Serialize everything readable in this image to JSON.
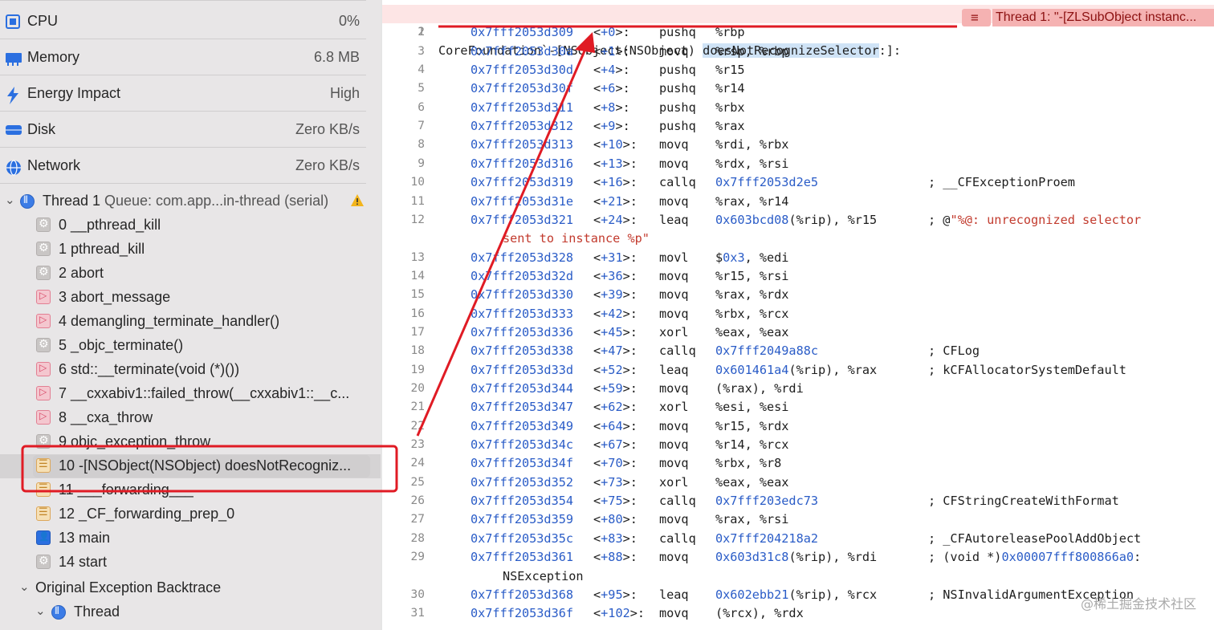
{
  "gauges": [
    {
      "label": "CPU",
      "value": "0%"
    },
    {
      "label": "Memory",
      "value": "6.8 MB"
    },
    {
      "label": "Energy Impact",
      "value": "High"
    },
    {
      "label": "Disk",
      "value": "Zero KB/s"
    },
    {
      "label": "Network",
      "value": "Zero KB/s"
    }
  ],
  "thread": {
    "name": "Thread 1",
    "queue": "Queue: com.app...in-thread (serial)"
  },
  "frames": [
    {
      "label": "0 __pthread_kill",
      "icon": "gear"
    },
    {
      "label": "1 pthread_kill",
      "icon": "gear"
    },
    {
      "label": "2 abort",
      "icon": "gear"
    },
    {
      "label": "3 abort_message",
      "icon": "cpp"
    },
    {
      "label": "4 demangling_terminate_handler()",
      "icon": "cpp"
    },
    {
      "label": "5 _objc_terminate()",
      "icon": "gear"
    },
    {
      "label": "6 std::__terminate(void (*)())",
      "icon": "cpp"
    },
    {
      "label": "7 __cxxabiv1::failed_throw(__cxxabiv1::__c...",
      "icon": "cpp"
    },
    {
      "label": "8 __cxa_throw",
      "icon": "cpp"
    },
    {
      "label": "9 objc_exception_throw",
      "icon": "gear"
    },
    {
      "label": "10 -[NSObject(NSObject) doesNotRecogniz...",
      "icon": "objc"
    },
    {
      "label": "11 ___forwarding___",
      "icon": "objc"
    },
    {
      "label": "12 _CF_forwarding_prep_0",
      "icon": "objc"
    },
    {
      "label": "13 main",
      "icon": "user"
    },
    {
      "label": "14 start",
      "icon": "gear"
    }
  ],
  "original_backtrace": {
    "label": "Original Exception Backtrace",
    "thread_label": "Thread"
  },
  "editor": {
    "line1": {
      "num": "1",
      "prefix": "CoreFoundation`-[NSObject(NSObject) ",
      "selected": "doesNotRecognizeSelector",
      "suffix": ":]:"
    },
    "error_message": "Thread 1: \"-[ZLSubObject instanc...",
    "lines": [
      {
        "n": "2",
        "addr": "0x7fff2053d309",
        "off": "+0",
        "mn": "pushq",
        "ops": "%rbp"
      },
      {
        "n": "3",
        "addr": "0x7fff2053d30a",
        "off": "+1",
        "mn": "movq",
        "ops": "%rsp, %rbp"
      },
      {
        "n": "4",
        "addr": "0x7fff2053d30d",
        "off": "+4",
        "mn": "pushq",
        "ops": "%r15"
      },
      {
        "n": "5",
        "addr": "0x7fff2053d30f",
        "off": "+6",
        "mn": "pushq",
        "ops": "%r14"
      },
      {
        "n": "6",
        "addr": "0x7fff2053d311",
        "off": "+8",
        "mn": "pushq",
        "ops": "%rbx"
      },
      {
        "n": "7",
        "addr": "0x7fff2053d312",
        "off": "+9",
        "mn": "pushq",
        "ops": "%rax"
      },
      {
        "n": "8",
        "addr": "0x7fff2053d313",
        "off": "+10",
        "mn": "movq",
        "ops": "%rdi, %rbx"
      },
      {
        "n": "9",
        "addr": "0x7fff2053d316",
        "off": "+13",
        "mn": "movq",
        "ops": "%rdx, %rsi"
      },
      {
        "n": "10",
        "addr": "0x7fff2053d319",
        "off": "+16",
        "mn": "callq",
        "ops_num": "0x7fff2053d2e5",
        "cm": "; __CFExceptionProem"
      },
      {
        "n": "11",
        "addr": "0x7fff2053d31e",
        "off": "+21",
        "mn": "movq",
        "ops": "%rax, %r14"
      },
      {
        "n": "12",
        "addr": "0x7fff2053d321",
        "off": "+24",
        "mn": "leaq",
        "ops_num": "0x603bcd08",
        "ops_tail": "(%rip), %r15",
        "cm": "; @",
        "cm_str": "\"%@: unrecognized selector",
        "wrap_str": "sent to instance %p\""
      },
      {
        "n": "13",
        "addr": "0x7fff2053d328",
        "off": "+31",
        "mn": "movl",
        "ops_pre": "$",
        "ops_num": "0x3",
        "ops_tail": ", %edi"
      },
      {
        "n": "14",
        "addr": "0x7fff2053d32d",
        "off": "+36",
        "mn": "movq",
        "ops": "%r15, %rsi"
      },
      {
        "n": "15",
        "addr": "0x7fff2053d330",
        "off": "+39",
        "mn": "movq",
        "ops": "%rax, %rdx"
      },
      {
        "n": "16",
        "addr": "0x7fff2053d333",
        "off": "+42",
        "mn": "movq",
        "ops": "%rbx, %rcx"
      },
      {
        "n": "17",
        "addr": "0x7fff2053d336",
        "off": "+45",
        "mn": "xorl",
        "ops": "%eax, %eax"
      },
      {
        "n": "18",
        "addr": "0x7fff2053d338",
        "off": "+47",
        "mn": "callq",
        "ops_num": "0x7fff2049a88c",
        "cm": "; CFLog"
      },
      {
        "n": "19",
        "addr": "0x7fff2053d33d",
        "off": "+52",
        "mn": "leaq",
        "ops_num": "0x601461a4",
        "ops_tail": "(%rip), %rax",
        "cm": "; kCFAllocatorSystemDefault"
      },
      {
        "n": "20",
        "addr": "0x7fff2053d344",
        "off": "+59",
        "mn": "movq",
        "ops": "(%rax), %rdi"
      },
      {
        "n": "21",
        "addr": "0x7fff2053d347",
        "off": "+62",
        "mn": "xorl",
        "ops": "%esi, %esi"
      },
      {
        "n": "22",
        "addr": "0x7fff2053d349",
        "off": "+64",
        "mn": "movq",
        "ops": "%r15, %rdx"
      },
      {
        "n": "23",
        "addr": "0x7fff2053d34c",
        "off": "+67",
        "mn": "movq",
        "ops": "%r14, %rcx"
      },
      {
        "n": "24",
        "addr": "0x7fff2053d34f",
        "off": "+70",
        "mn": "movq",
        "ops": "%rbx, %r8"
      },
      {
        "n": "25",
        "addr": "0x7fff2053d352",
        "off": "+73",
        "mn": "xorl",
        "ops": "%eax, %eax"
      },
      {
        "n": "26",
        "addr": "0x7fff2053d354",
        "off": "+75",
        "mn": "callq",
        "ops_num": "0x7fff203edc73",
        "cm": "; CFStringCreateWithFormat"
      },
      {
        "n": "27",
        "addr": "0x7fff2053d359",
        "off": "+80",
        "mn": "movq",
        "ops": "%rax, %rsi"
      },
      {
        "n": "28",
        "addr": "0x7fff2053d35c",
        "off": "+83",
        "mn": "callq",
        "ops_num": "0x7fff204218a2",
        "cm": "; _CFAutoreleasePoolAddObject"
      },
      {
        "n": "29",
        "addr": "0x7fff2053d361",
        "off": "+88",
        "mn": "movq",
        "ops_num": "0x603d31c8",
        "ops_tail": "(%rip), %rdi",
        "cm": "; (void *)",
        "cm_num": "0x00007fff800866a0",
        "cm_tail": ":",
        "wrap_plain": "NSException"
      },
      {
        "n": "30",
        "addr": "0x7fff2053d368",
        "off": "+95",
        "mn": "leaq",
        "ops_num": "0x602ebb21",
        "ops_tail": "(%rip), %rcx",
        "cm": "; NSInvalidArgumentException"
      },
      {
        "n": "31",
        "addr": "0x7fff2053d36f",
        "off": "+102",
        "mn": "movq",
        "ops": "(%rcx), %rdx"
      }
    ]
  },
  "watermark": "@稀土掘金技术社区",
  "colors": {
    "annotation_red": "#e01b24",
    "error_bg": "#f5b2b2",
    "address_blue": "#2a5cc7",
    "string_red": "#c23a2d"
  }
}
